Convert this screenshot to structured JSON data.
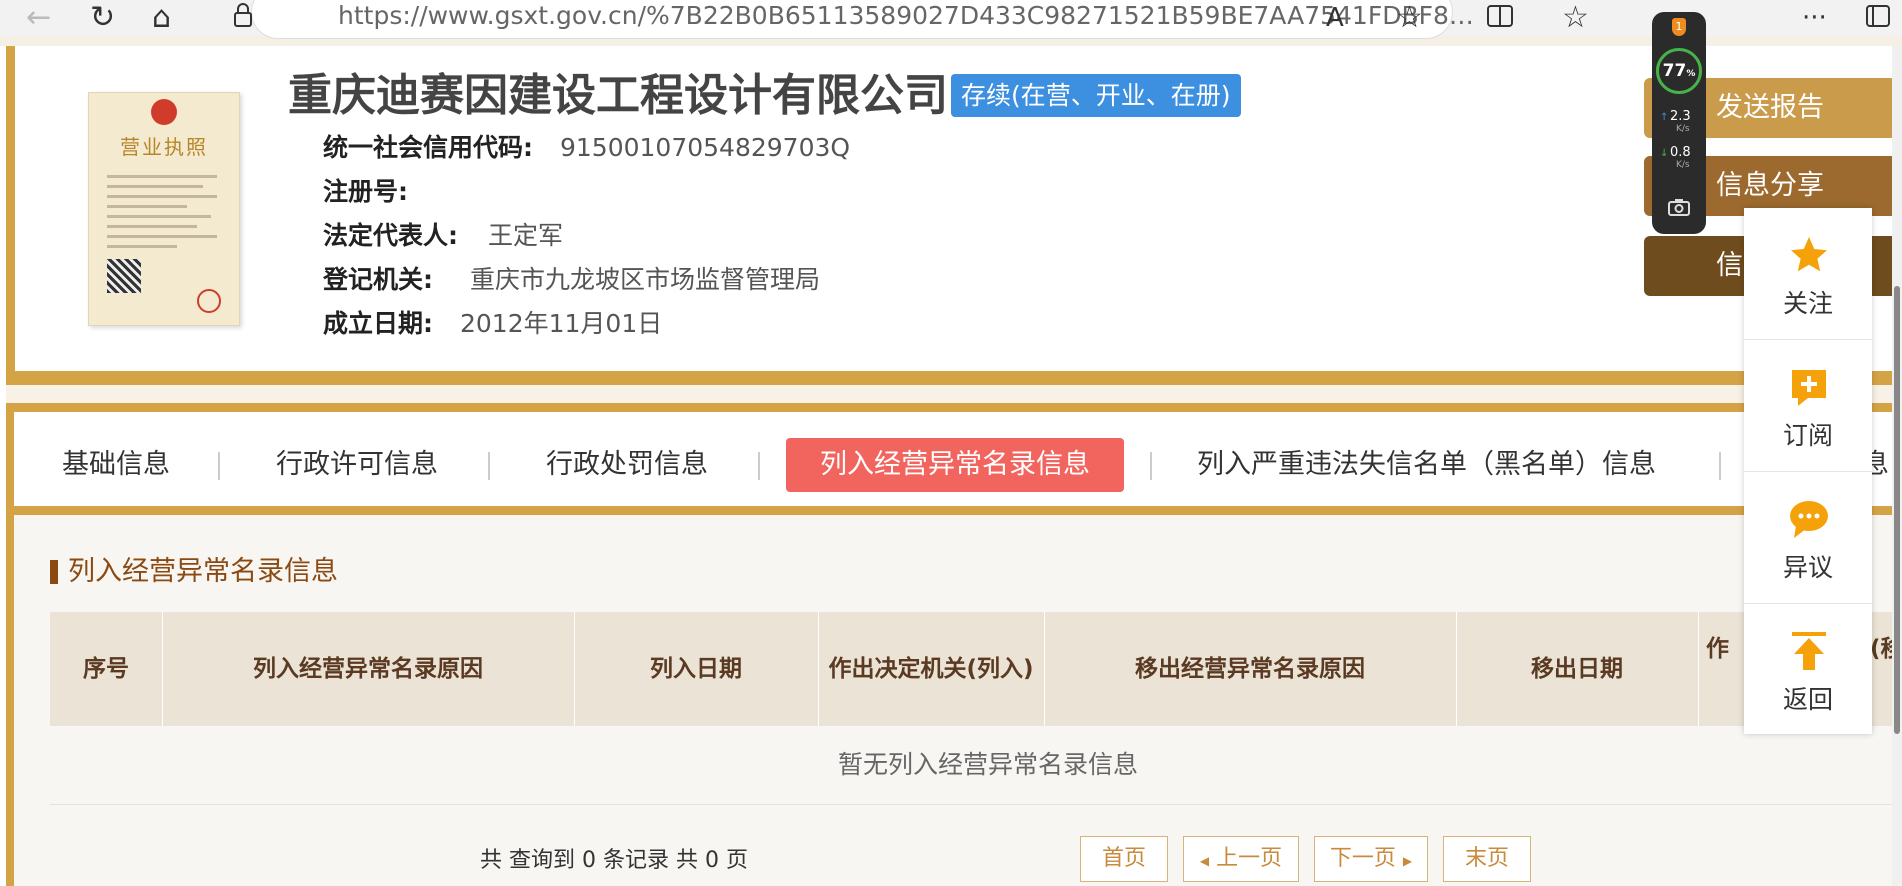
{
  "browser": {
    "url": "https://www.gsxt.gov.cn/%7B22B0B65113589027D433C98271521B59BE7AA7541FDBF8…",
    "back_icon": "←",
    "refresh_icon": "↻",
    "home_icon": "⌂",
    "lock_icon": "🔒",
    "read_icon": "A",
    "star_icon": "☆",
    "split_icon": "▯",
    "favorites_icon": "☆",
    "more_icon": "···"
  },
  "monitor": {
    "percent": "77",
    "percent_sign": "%",
    "badge": "1",
    "up_rate": "2.3",
    "up_unit": "K/s",
    "down_rate": "0.8",
    "down_unit": "K/s"
  },
  "company": {
    "name": "重庆迪赛因建设工程设计有限公司",
    "status": "存续(在营、开业、在册)",
    "credit_code_label": "统一社会信用代码:",
    "credit_code": "91500107054829703Q",
    "reg_no_label": "注册号:",
    "reg_no": "",
    "legal_rep_label": "法定代表人:",
    "legal_rep": "王定军",
    "authority_label": "登记机关:",
    "authority": "重庆市九龙坡区市场监督管理局",
    "founded_label": "成立日期:",
    "founded": "2012年11月01日",
    "license_title": "营业执照"
  },
  "actions": {
    "send_report": "发送报告",
    "share": "信息分享",
    "third_partial": "信"
  },
  "tabs": [
    {
      "label": "基础信息"
    },
    {
      "label": "行政许可信息"
    },
    {
      "label": "行政处罚信息"
    },
    {
      "label": "列入经营异常名录信息"
    },
    {
      "label": "列入严重违法失信名单（黑名单）信息"
    },
    {
      "label": "息"
    }
  ],
  "section": {
    "title": "列入经营异常名录信息",
    "columns": [
      "序号",
      "列入经营异常名录原因",
      "列入日期",
      "作出决定机关(列入)",
      "移出经营异常名录原因",
      "移出日期",
      "作",
      "(移"
    ],
    "empty_message": "暂无列入经营异常名录信息"
  },
  "pagination": {
    "summary": "共 查询到 0 条记录 共 0 页",
    "first": "首页",
    "prev": "上一页",
    "next": "下一页",
    "last": "末页"
  },
  "float_panel": [
    {
      "label": "关注",
      "icon": "star-icon"
    },
    {
      "label": "订阅",
      "icon": "subscribe-plus-icon"
    },
    {
      "label": "异议",
      "icon": "comment-bubble-icon"
    },
    {
      "label": "返回",
      "icon": "back-to-top-icon"
    }
  ],
  "colors": {
    "gold": "#d4a346",
    "active_tab": "#f2655f",
    "status_badge": "#3d8fe0",
    "section_brown": "#8b4a12",
    "table_header": "#ebe3d5",
    "float_icon_orange": "#f5a20a"
  }
}
